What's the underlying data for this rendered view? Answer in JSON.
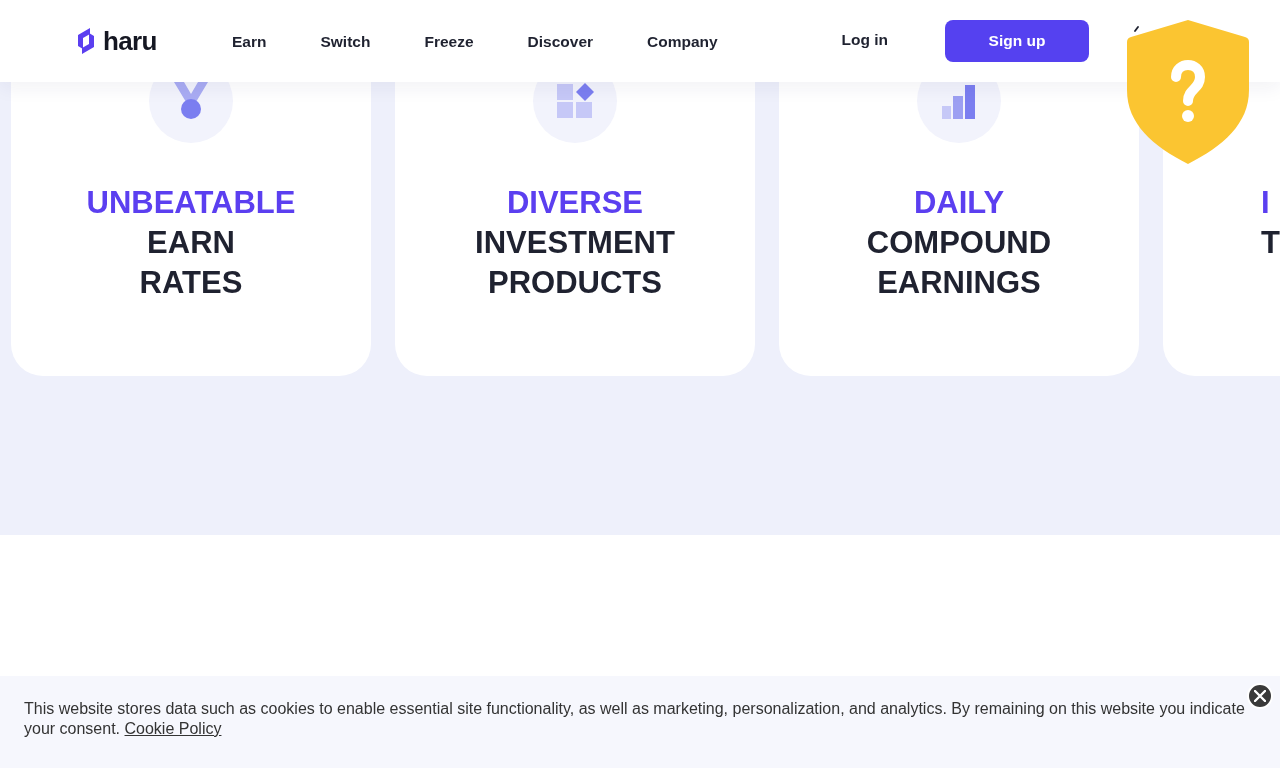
{
  "nav": {
    "logo": "haru",
    "links": [
      "Earn",
      "Switch",
      "Freeze",
      "Discover",
      "Company"
    ],
    "login": "Log in",
    "signup": "Sign up"
  },
  "cards": [
    {
      "kind": "medal",
      "lines": [
        {
          "text": "UNBEATABLE",
          "accent": true
        },
        {
          "text": "EARN",
          "accent": false
        },
        {
          "text": "RATES",
          "accent": false
        }
      ]
    },
    {
      "kind": "grid",
      "lines": [
        {
          "text": "DIVERSE",
          "accent": true
        },
        {
          "text": "INVESTMENT",
          "accent": false
        },
        {
          "text": "PRODUCTS",
          "accent": false
        }
      ]
    },
    {
      "kind": "bars",
      "lines": [
        {
          "text": "DAILY",
          "accent": true
        },
        {
          "text": "COMPOUND",
          "accent": false
        },
        {
          "text": "EARNINGS",
          "accent": false
        }
      ]
    },
    {
      "kind": "cut",
      "lines": [
        {
          "text": "I",
          "accent": true
        },
        {
          "text": "T",
          "accent": false
        }
      ]
    }
  ],
  "cookie": {
    "text": "This website stores data such as cookies to enable essential site functionality, as well as marketing, personalization, and analytics. By remaining on this website you indicate your consent.",
    "link": "Cookie Policy"
  }
}
